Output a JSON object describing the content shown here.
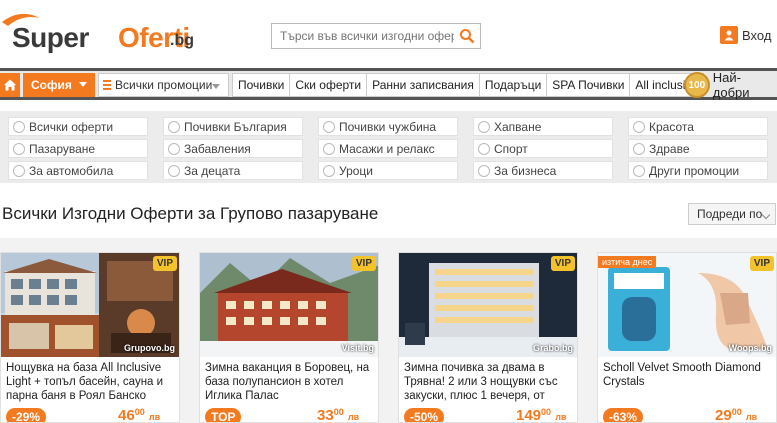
{
  "header": {
    "logo_super": "Super",
    "logo_oferti": "Oferti",
    "logo_bg": ".bg",
    "search_placeholder": "Търси във всички изгодни оферти",
    "login_label": "Вход"
  },
  "nav": {
    "city": "София",
    "promotions": "Всички промоции",
    "links": [
      "Почивки",
      "Ски оферти",
      "Ранни записвания",
      "Подаръци",
      "SPA Почивки",
      "All inclusive"
    ],
    "best_badge": "100",
    "best_label": "Най-добри"
  },
  "filters": {
    "columns": [
      [
        "Всички оферти",
        "Пазаруване",
        "За автомобила"
      ],
      [
        "Почивки България",
        "Забавления",
        "За децата"
      ],
      [
        "Почивки чужбина",
        "Масажи и релакс",
        "Уроци"
      ],
      [
        "Хапване",
        "Спорт",
        "За бизнеса"
      ],
      [
        "Красота",
        "Здраве",
        "Други промоции"
      ]
    ]
  },
  "main": {
    "title": "Всички Изгодни Оферти за Групово пазаруване",
    "sort_label": "Подреди по"
  },
  "cards": [
    {
      "vip": "VIP",
      "source": "Grupovo.bg",
      "desc": "Нощувка на база All Inclusive Light + топъл басейн, сауна и парна баня в Роял Банско",
      "discount": "-29%",
      "price_int": "46",
      "price_dec": "00",
      "currency": "лв"
    },
    {
      "vip": "VIP",
      "source": "Visit.bg",
      "desc": "Зимна ваканция в Боровец, на база полупансион в хотел Иглика Палас",
      "discount": "TOP",
      "price_int": "33",
      "price_dec": "00",
      "currency": "лв"
    },
    {
      "vip": "VIP",
      "source": "Grabo.bg",
      "desc": "Зимна почивка за двама в Трявна! 2 или 3 нощувки със закуски, плюс 1 вечеря, от",
      "discount": "-50%",
      "price_int": "149",
      "price_dec": "00",
      "currency": "лв"
    },
    {
      "vip": "VIP",
      "today": "изтича днес",
      "source": "Woops.bg",
      "desc": "Scholl Velvet Smooth Diamond Crystals",
      "discount": "-63%",
      "price_int": "29",
      "price_dec": "00",
      "currency": "лв"
    }
  ]
}
